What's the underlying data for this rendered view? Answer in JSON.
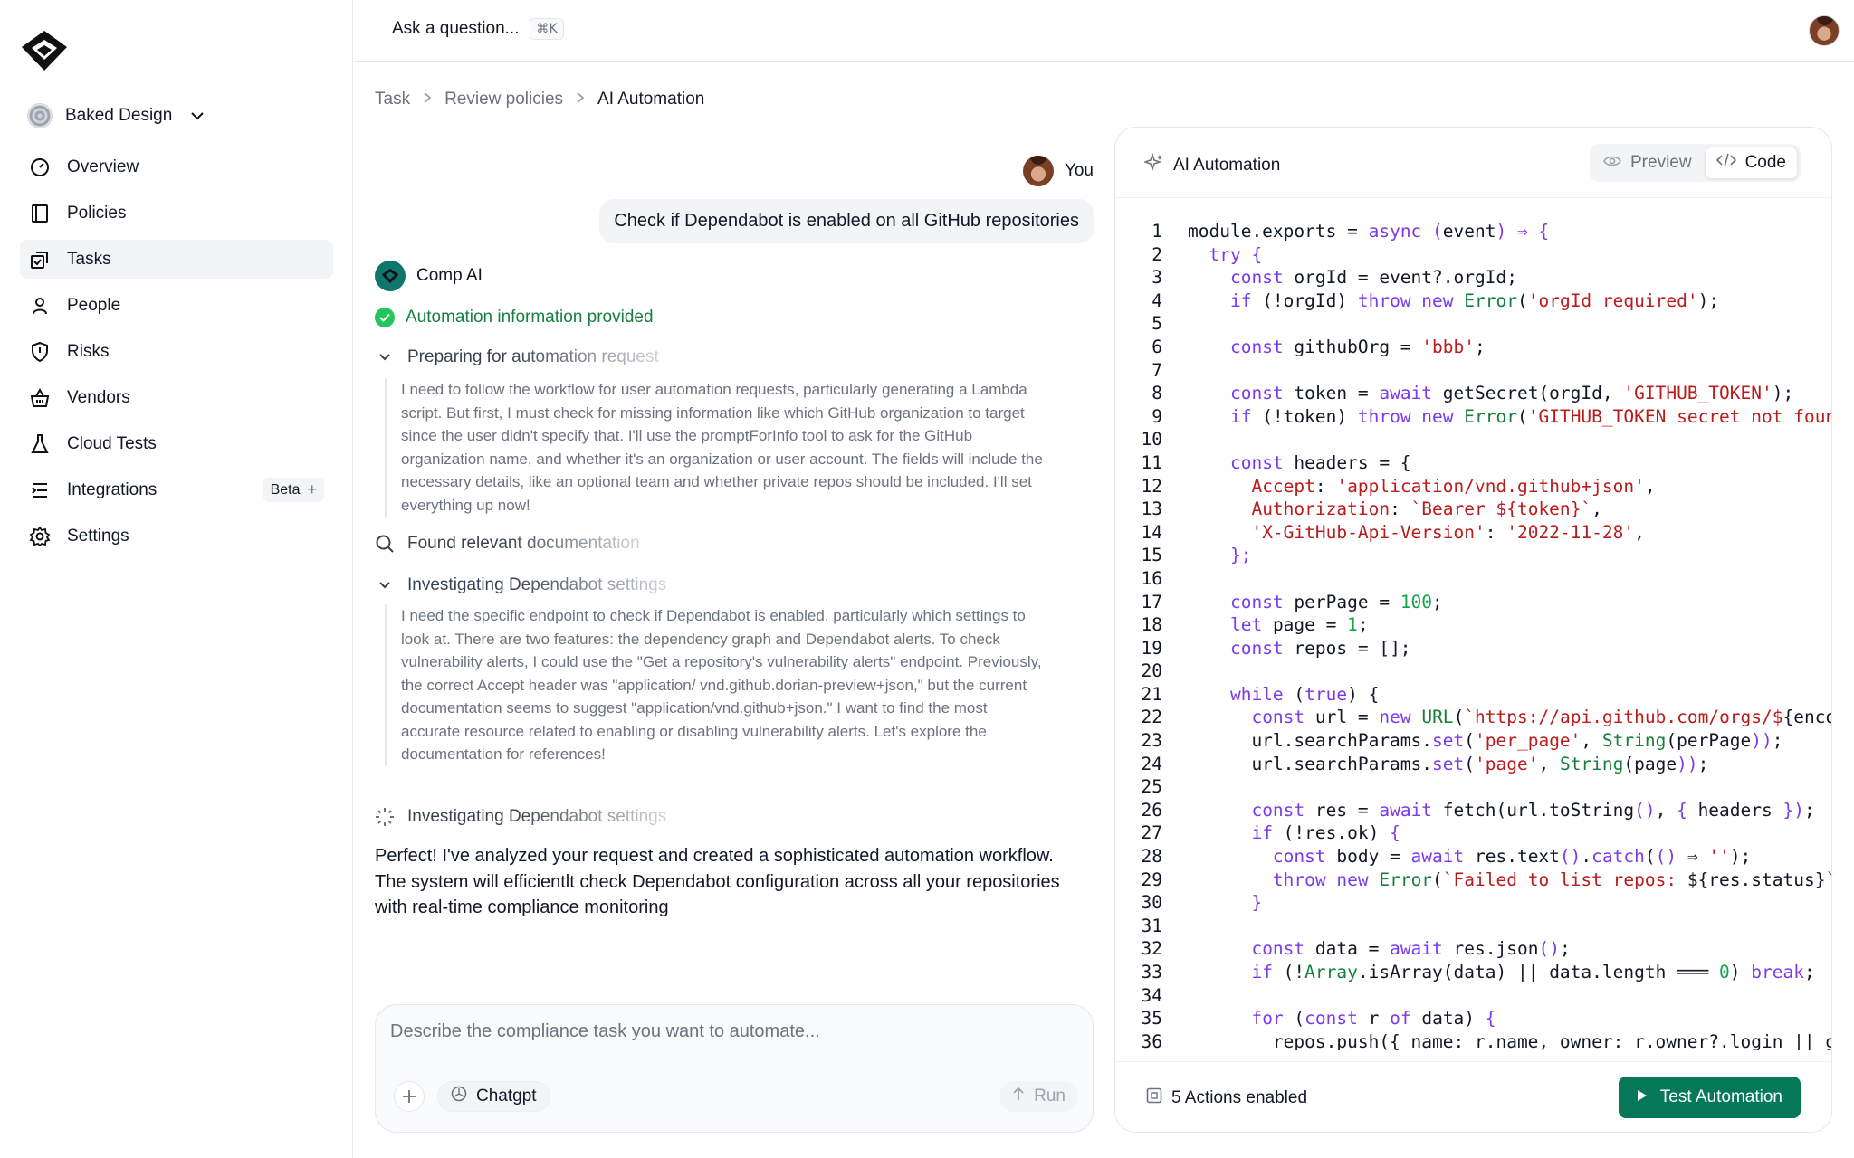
{
  "sidebar": {
    "org_name": "Baked Design",
    "items": [
      {
        "label": "Overview",
        "icon": "gauge-icon"
      },
      {
        "label": "Policies",
        "icon": "policies-icon"
      },
      {
        "label": "Tasks",
        "icon": "tasks-icon",
        "active": true
      },
      {
        "label": "People",
        "icon": "person-icon"
      },
      {
        "label": "Risks",
        "icon": "shield-alert-icon"
      },
      {
        "label": "Vendors",
        "icon": "basket-icon"
      },
      {
        "label": "Cloud Tests",
        "icon": "flask-icon"
      },
      {
        "label": "Integrations",
        "icon": "integrations-icon",
        "badge": "Beta"
      },
      {
        "label": "Settings",
        "icon": "gear-icon"
      }
    ]
  },
  "topbar": {
    "ask_label": "Ask a question...",
    "shortcut": "⌘K"
  },
  "breadcrumb": [
    "Task",
    "Review policies",
    "AI Automation"
  ],
  "chat": {
    "user_label": "You",
    "user_message": "Check if Dependabot is enabled on all GitHub repositories",
    "bot_name": "Comp AI",
    "status": "Automation information provided",
    "step1_title": "Preparing for automation request",
    "step1_body": "I need to follow the workflow for user automation requests, particularly generating a Lambda script. But first, I must check for missing information like which GitHub organization to target since the user didn't specify that. I'll use the promptForInfo tool to ask for the GitHub organization name, and whether it's an organization or user account. The fields will include the necessary details, like an optional team and whether private repos should be included. I'll set everything up now!",
    "step2_title": "Found relevant documentation",
    "step3_title": "Investigating Dependabot settings",
    "step3_body": "I need the specific endpoint to check if Dependabot is enabled, particularly which settings to look at. There are two features: the dependency graph and Dependabot alerts. To check vulnerability alerts, I could use the \"Get a repository's vulnerability alerts\" endpoint. Previously, the correct Accept header was \"application/ vnd.github.dorian-preview+json,\" but the current documentation seems to suggest \"application/vnd.github+json.\" I want to find the most accurate resource related to enabling or disabling vulnerability alerts. Let's explore the documentation for references!",
    "step4_title": "Investigating Dependabot settings",
    "answer": "Perfect! I've analyzed your request and created a sophisticated automation workflow. The system will efficientlt check Dependabot configuration across all your repositories with real-time compliance monitoring"
  },
  "composer": {
    "placeholder": "Describe the compliance task you want to automate...",
    "model": "Chatgpt",
    "run_label": "Run"
  },
  "panel": {
    "title": "AI Automation",
    "preview_label": "Preview",
    "code_label": "Code",
    "actions_label": "5 Actions enabled",
    "test_label": "Test Automation",
    "accent": "#047857"
  }
}
